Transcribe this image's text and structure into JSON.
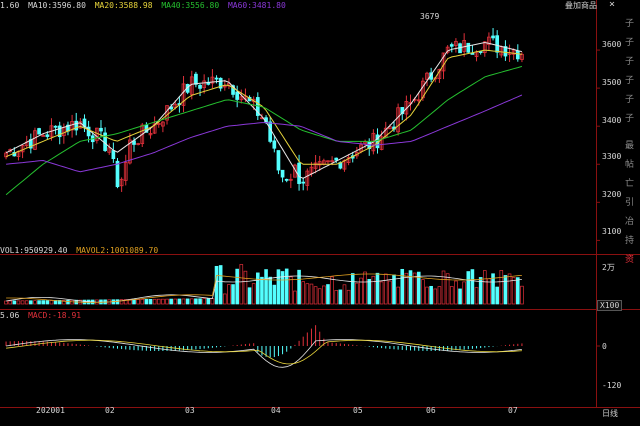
{
  "legends": {
    "price": {
      "items": [
        {
          "text": "1.60",
          "color": "#d9d9d9"
        },
        {
          "text": "MA10:3596.80",
          "color": "#d9d9d9"
        },
        {
          "text": "MA20:3588.98",
          "color": "#e6d33b"
        },
        {
          "text": "MA40:3556.80",
          "color": "#25c02f"
        },
        {
          "text": "MA60:3481.80",
          "color": "#8a38d8"
        }
      ]
    },
    "volume": {
      "items": [
        {
          "text": "VOL1:950929.40",
          "color": "#d9d9d9"
        },
        {
          "text": "MAVOL2:1001089.70",
          "color": "#e0a020"
        }
      ]
    },
    "macd": {
      "items": [
        {
          "text": "5.06",
          "color": "#d9d9d9"
        },
        {
          "text": "MACD:-18.91",
          "color": "#e0303a"
        }
      ]
    }
  },
  "toolbar": {
    "overlay_label": "叠加商品",
    "close_label": "×"
  },
  "price_axis": [
    "3600",
    "3500",
    "3400",
    "3300",
    "3200",
    "3100"
  ],
  "volume_axis": [
    "2万"
  ],
  "volume_unit": "X100",
  "macd_axis": [
    "0",
    "-120"
  ],
  "date_axis": [
    "202001",
    "02",
    "03",
    "04",
    "05",
    "06",
    "07"
  ],
  "period_label": "日线",
  "peak_annotation": "3679",
  "side_labels": [
    "子",
    "子",
    "子",
    "子",
    "子",
    "子",
    "最",
    "帖",
    "亡",
    "引",
    "冶",
    "持",
    "资"
  ],
  "colors": {
    "up": "#e0303a",
    "down": "#54ffff",
    "frame": "#8a1010",
    "ma10": "#e8e8e8",
    "ma20": "#e6d33b",
    "ma40": "#25c02f",
    "ma60": "#8a38d8"
  },
  "chart_data": [
    {
      "type": "candlestick",
      "title": "",
      "ylim": [
        3080,
        3700
      ],
      "yticks": [
        3600,
        3500,
        3400,
        3300,
        3200,
        3100
      ],
      "x_ticks": [
        "202001",
        "02",
        "03",
        "04",
        "05",
        "06",
        "07"
      ],
      "annotation_max": 3679,
      "series": [
        {
          "name": "MA10",
          "values_anchor": [
            3330,
            3380,
            3410,
            3330,
            3400,
            3510,
            3520,
            3420,
            3260,
            3310,
            3360,
            3460,
            3600,
            3620,
            3596
          ]
        },
        {
          "name": "MA20",
          "values_anchor": [
            3320,
            3360,
            3400,
            3360,
            3400,
            3480,
            3510,
            3450,
            3300,
            3300,
            3350,
            3430,
            3580,
            3600,
            3589
          ]
        },
        {
          "name": "MA40",
          "values_anchor": [
            3220,
            3300,
            3360,
            3380,
            3410,
            3440,
            3470,
            3450,
            3390,
            3360,
            3360,
            3390,
            3470,
            3530,
            3557
          ]
        },
        {
          "name": "MA60",
          "values_anchor": [
            3300,
            3310,
            3280,
            3300,
            3330,
            3370,
            3400,
            3410,
            3400,
            3360,
            3350,
            3360,
            3400,
            3440,
            3482
          ]
        }
      ]
    },
    {
      "type": "bar",
      "title": "",
      "ylabel": "VOL",
      "yticks_labels": [
        "2万"
      ],
      "unit": "X100",
      "series": [
        {
          "name": "VOL1",
          "last": 950929.4
        },
        {
          "name": "MAVOL2",
          "last": 1001089.7
        }
      ]
    },
    {
      "type": "bar",
      "title": "",
      "ylabel": "MACD",
      "yticks": [
        0,
        -120
      ],
      "series": [
        {
          "name": "MACD",
          "last": -18.91
        }
      ]
    }
  ]
}
